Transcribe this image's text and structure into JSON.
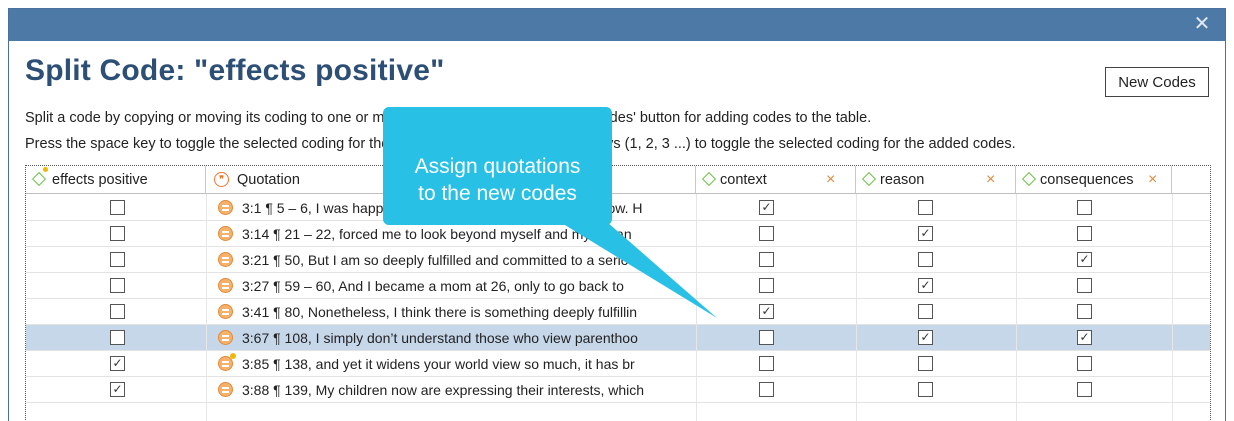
{
  "window": {
    "close_icon": "close-icon"
  },
  "heading": "Split Code: \"effects positive\"",
  "new_codes_button": "New Codes",
  "instructions": {
    "line1": "Split a code by copying or moving its coding to one or more new codes. Use the 'Create Codes' button for adding codes to the table.",
    "line2": "Press the space key to toggle the selected coding for the original code. Use the number keys (1, 2, 3 ...) to toggle the selected coding for the added codes."
  },
  "columns": {
    "source": "effects positive",
    "quotation": "Quotation",
    "context": "context",
    "reason": "reason",
    "consequences": "consequences",
    "remove_glyph": "×"
  },
  "rows": [
    {
      "text": "3:1 ¶ 5 – 6, I was happy then, and I am even more happy now. H",
      "source": false,
      "context": true,
      "reason": false,
      "consequences": false,
      "selected": false,
      "commented": false
    },
    {
      "text": "3:14 ¶ 21 – 22, forced me to look beyond myself and myself an",
      "source": false,
      "context": false,
      "reason": true,
      "consequences": false,
      "selected": false,
      "commented": false
    },
    {
      "text": "3:21 ¶ 50, But I am so deeply fulfilled and committed to a seriou",
      "source": false,
      "context": false,
      "reason": false,
      "consequences": true,
      "selected": false,
      "commented": false
    },
    {
      "text": "3:27 ¶ 59 – 60, And I became a mom at 26, only to go back to",
      "source": false,
      "context": false,
      "reason": true,
      "consequences": false,
      "selected": false,
      "commented": false
    },
    {
      "text": "3:41 ¶ 80, Nonetheless, I think there is something deeply fulfillin",
      "source": false,
      "context": true,
      "reason": false,
      "consequences": false,
      "selected": false,
      "commented": false
    },
    {
      "text": "3:67 ¶ 108, I simply don’t understand those who view parenthoo",
      "source": false,
      "context": false,
      "reason": true,
      "consequences": true,
      "selected": true,
      "commented": false
    },
    {
      "text": "3:85 ¶ 138, and yet it widens your world view so much, it has br",
      "source": true,
      "context": false,
      "reason": false,
      "consequences": false,
      "selected": false,
      "commented": true
    },
    {
      "text": "3:88 ¶ 139, My children now are expressing their interests, which",
      "source": true,
      "context": false,
      "reason": false,
      "consequences": false,
      "selected": false,
      "commented": false
    }
  ],
  "callout": {
    "text": "Assign quotations\nto the new codes"
  },
  "colors": {
    "titlebar": "#4d79a7",
    "heading": "#2d4f75",
    "callout": "#29c0e6",
    "code_icon": "#6cc24a",
    "quotation_icon": "#e9782f",
    "selected_row": "#c7d7ea"
  }
}
